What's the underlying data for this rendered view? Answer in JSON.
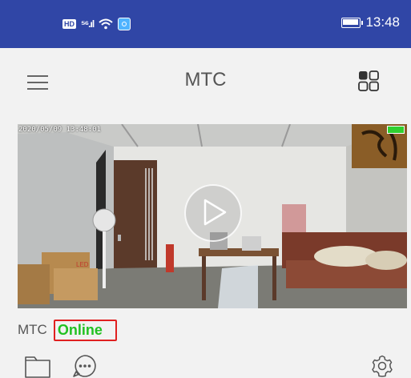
{
  "status_bar": {
    "hd": "HD",
    "network": "⁵⁶.ıl",
    "time": "13:48"
  },
  "header": {
    "title": "MTC"
  },
  "camera": {
    "timestamp": "2020/05/09 13:48:01",
    "door_sign": "LED"
  },
  "device": {
    "name": "MTC",
    "status": "Online"
  },
  "colors": {
    "status_bar": "#3046a6",
    "online": "#22c122",
    "highlight_box": "#e02020"
  },
  "icons": [
    "menu-icon",
    "grid-icon",
    "play-icon",
    "folder-icon",
    "message-icon",
    "settings-icon"
  ]
}
